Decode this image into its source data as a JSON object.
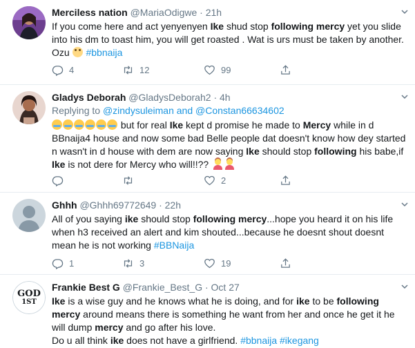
{
  "tweets": [
    {
      "name": "Merciless nation",
      "handle": "@MariaOdigwe",
      "time": "21h",
      "segments": [
        {
          "t": "If you come here and act yenyenyen "
        },
        {
          "t": "Ike",
          "b": true
        },
        {
          "t": " shud stop "
        },
        {
          "t": "following mercy",
          "b": true
        },
        {
          "t": " yet you slide into his dm to toast him, you will get roasted . Wat is urs must be taken by another. Ozu "
        },
        {
          "emoji": "rolling-eyes"
        },
        {
          "t": " "
        },
        {
          "t": "#bbnaija",
          "link": true
        }
      ],
      "replies": "4",
      "retweets": "12",
      "likes": "99"
    },
    {
      "name": "Gladys Deborah",
      "handle": "@GladysDeborah2",
      "time": "4h",
      "replying_prefix": "Replying to ",
      "replying_to": "@zindysuleiman and @Constan66634602",
      "segments": [
        {
          "emoji": "joy"
        },
        {
          "emoji": "joy"
        },
        {
          "emoji": "joy"
        },
        {
          "emoji": "joy"
        },
        {
          "emoji": "joy"
        },
        {
          "emoji": "joy"
        },
        {
          "t": " but for real "
        },
        {
          "t": "Ike",
          "b": true
        },
        {
          "t": "  kept d promise he made to "
        },
        {
          "t": "Mercy",
          "b": true
        },
        {
          "t": " while in d BBnaija4 house and now some bad Belle people dat doesn't know how dey started n wasn't in d house with dem are now saying "
        },
        {
          "t": "Ike",
          "b": true
        },
        {
          "t": "  should stop "
        },
        {
          "t": "following",
          "b": true
        },
        {
          "t": " his babe,if "
        },
        {
          "t": "Ike",
          "b": true
        },
        {
          "t": " is not dere for Mercy who will!!?? "
        },
        {
          "emoji": "person-shrugging"
        },
        {
          "emoji": "person-shrugging"
        }
      ],
      "replies": "",
      "retweets": "",
      "likes": "2"
    },
    {
      "name": "Ghhh",
      "handle": "@Ghhh69772649",
      "time": "22h",
      "segments": [
        {
          "t": "All of you saying "
        },
        {
          "t": "ike",
          "b": true
        },
        {
          "t": " should stop "
        },
        {
          "t": "following mercy",
          "b": true
        },
        {
          "t": "...hope you heard it on his life when h3 received an alert and kim shouted...because he doesnt shout doesnt mean he is not working "
        },
        {
          "t": "#BBNaija",
          "link": true
        }
      ],
      "replies": "1",
      "retweets": "3",
      "likes": "19"
    },
    {
      "name": "Frankie Best G",
      "handle": "@Frankie_Best_G",
      "time": "Oct 27",
      "avatar_text_1": "GOD",
      "avatar_text_2": "1ST",
      "segments": [
        {
          "t": "Ike",
          "b": true
        },
        {
          "t": " is a wise guy and he knows what he is doing, and for "
        },
        {
          "t": "ike",
          "b": true
        },
        {
          "t": " to be "
        },
        {
          "t": "following",
          "b": true
        },
        {
          "br": true
        },
        {
          "t": " "
        },
        {
          "t": "mercy",
          "b": true
        },
        {
          "t": " around means there is something he want from her and once he get it he will dump "
        },
        {
          "t": "mercy",
          "b": true
        },
        {
          "t": " and go after his love."
        },
        {
          "br": true
        },
        {
          "t": "Do u all think "
        },
        {
          "t": "ike",
          "b": true
        },
        {
          "t": " does not have a girlfriend. "
        },
        {
          "t": "#bbnaija",
          "link": true
        },
        {
          "t": " "
        },
        {
          "t": "#ikegang",
          "link": true
        }
      ]
    }
  ],
  "icons": {
    "reply": "reply-icon",
    "retweet": "retweet-icon",
    "like": "like-icon",
    "share": "share-icon",
    "more": "chevron-down-icon"
  },
  "colors": {
    "text": "#14171a",
    "muted": "#657786",
    "link": "#1b95e0",
    "divider": "#e6ecf0"
  }
}
